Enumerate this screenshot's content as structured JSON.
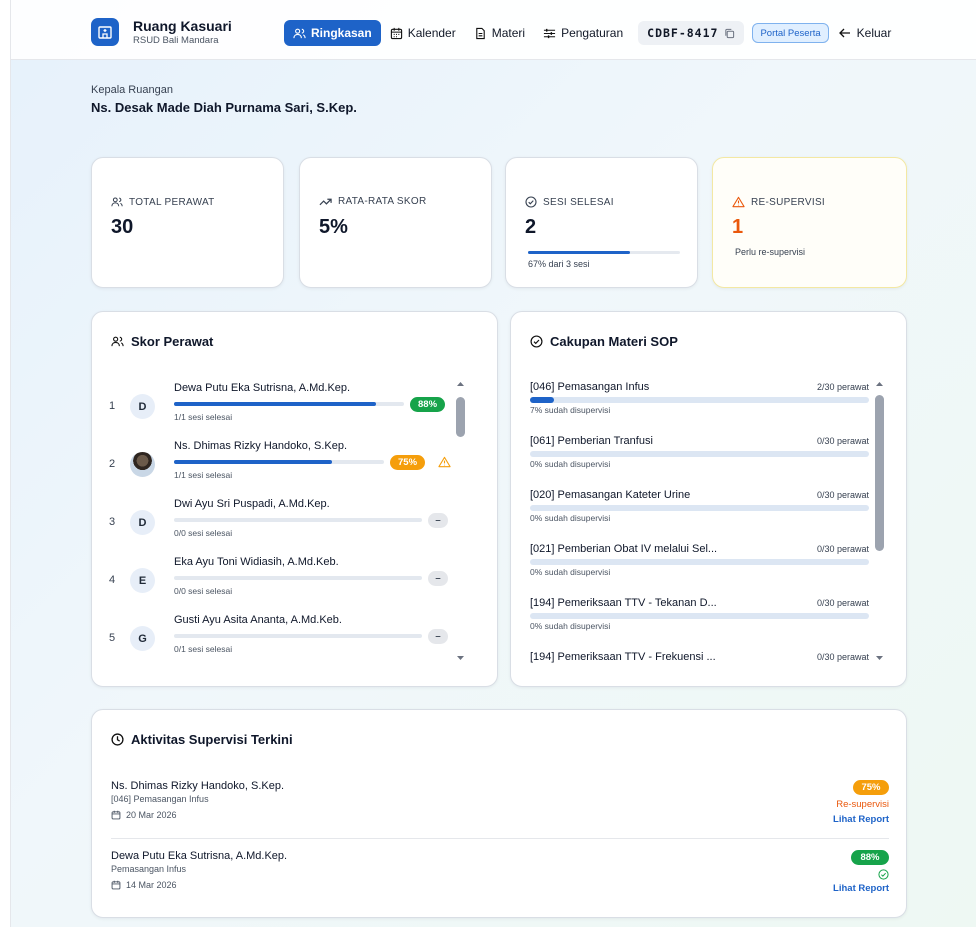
{
  "header": {
    "brand_title": "Ruang Kasuari",
    "brand_subtitle": "RSUD Bali Mandara",
    "nav": [
      {
        "label": "Ringkasan",
        "icon": "users-icon",
        "active": true
      },
      {
        "label": "Kalender",
        "icon": "calendar-icon",
        "active": false
      },
      {
        "label": "Materi",
        "icon": "document-icon",
        "active": false
      },
      {
        "label": "Pengaturan",
        "icon": "sliders-icon",
        "active": false
      }
    ],
    "code": "CDBF-8417",
    "portal_badge": "Portal Peserta",
    "logout_label": "Keluar"
  },
  "head_nurse": {
    "label": "Kepala Ruangan",
    "name": "Ns. Desak Made Diah Purnama Sari, S.Kep."
  },
  "stats": {
    "total_nurses": {
      "label": "TOTAL PERAWAT",
      "value": "30"
    },
    "avg_score": {
      "label": "RATA-RATA SKOR",
      "value": "5%"
    },
    "sessions_done": {
      "label": "SESI SELESAI",
      "value": "2",
      "note": "67% dari 3 sesi",
      "progress": 0.67
    },
    "re_supervision": {
      "label": "RE-SUPERVISI",
      "value": "1",
      "note": "Perlu re-supervisi"
    }
  },
  "nurse_scores": {
    "title": "Skor Perawat",
    "items": [
      {
        "rank": "1",
        "initial": "D",
        "name": "Dewa Putu Eka Sutrisna, A.Md.Kep.",
        "sub": "1/1 sesi selesai",
        "score": "88%",
        "progress": 0.88,
        "pill": "green"
      },
      {
        "rank": "2",
        "initial": "",
        "name": "Ns. Dhimas Rizky Handoko, S.Kep.",
        "sub": "1/1 sesi selesai",
        "score": "75%",
        "progress": 0.75,
        "pill": "orange"
      },
      {
        "rank": "3",
        "initial": "D",
        "name": "Dwi Ayu Sri Puspadi, A.Md.Kep.",
        "sub": "0/0 sesi selesai",
        "score": "–",
        "progress": 0,
        "pill": "gray"
      },
      {
        "rank": "4",
        "initial": "E",
        "name": "Eka Ayu Toni Widiasih, A.Md.Keb.",
        "sub": "0/0 sesi selesai",
        "score": "–",
        "progress": 0,
        "pill": "gray"
      },
      {
        "rank": "5",
        "initial": "G",
        "name": "Gusti Ayu Asita Ananta, A.Md.Keb.",
        "sub": "0/1 sesi selesai",
        "score": "–",
        "progress": 0,
        "pill": "gray"
      }
    ]
  },
  "sop_coverage": {
    "title": "Cakupan Materi SOP",
    "items": [
      {
        "title": "[046] Pemasangan Infus",
        "count": "2/30 perawat",
        "sub": "7% sudah disupervisi",
        "progress": 0.07
      },
      {
        "title": "[061] Pemberian Tranfusi",
        "count": "0/30 perawat",
        "sub": "0% sudah disupervisi",
        "progress": 0
      },
      {
        "title": "[020] Pemasangan Kateter Urine",
        "count": "0/30 perawat",
        "sub": "0% sudah disupervisi",
        "progress": 0
      },
      {
        "title": "[021] Pemberian Obat IV melalui Sel...",
        "count": "0/30 perawat",
        "sub": "0% sudah disupervisi",
        "progress": 0
      },
      {
        "title": "[194] Pemeriksaan TTV - Tekanan D...",
        "count": "0/30 perawat",
        "sub": "0% sudah disupervisi",
        "progress": 0
      },
      {
        "title": "[194] Pemeriksaan TTV - Frekuensi ...",
        "count": "0/30 perawat",
        "sub": "",
        "progress": 0
      }
    ]
  },
  "activity": {
    "title": "Aktivitas Supervisi Terkini",
    "items": [
      {
        "name": "Ns. Dhimas Rizky Handoko, S.Kep.",
        "topic": "[046] Pemasangan Infus",
        "date": "20 Mar 2026",
        "score": "75%",
        "status": "Re-supervisi",
        "link": "Lihat Report"
      },
      {
        "name": "Dewa Putu Eka Sutrisna, A.Md.Kep.",
        "topic": "Pemasangan Infus",
        "date": "14 Mar 2026",
        "score": "88%",
        "status": "",
        "link": "Lihat Report"
      }
    ]
  },
  "colors": {
    "primary": "#1e63c8",
    "success": "#16a34a",
    "warning": "#f59e0b",
    "danger_text": "#ea580c"
  }
}
